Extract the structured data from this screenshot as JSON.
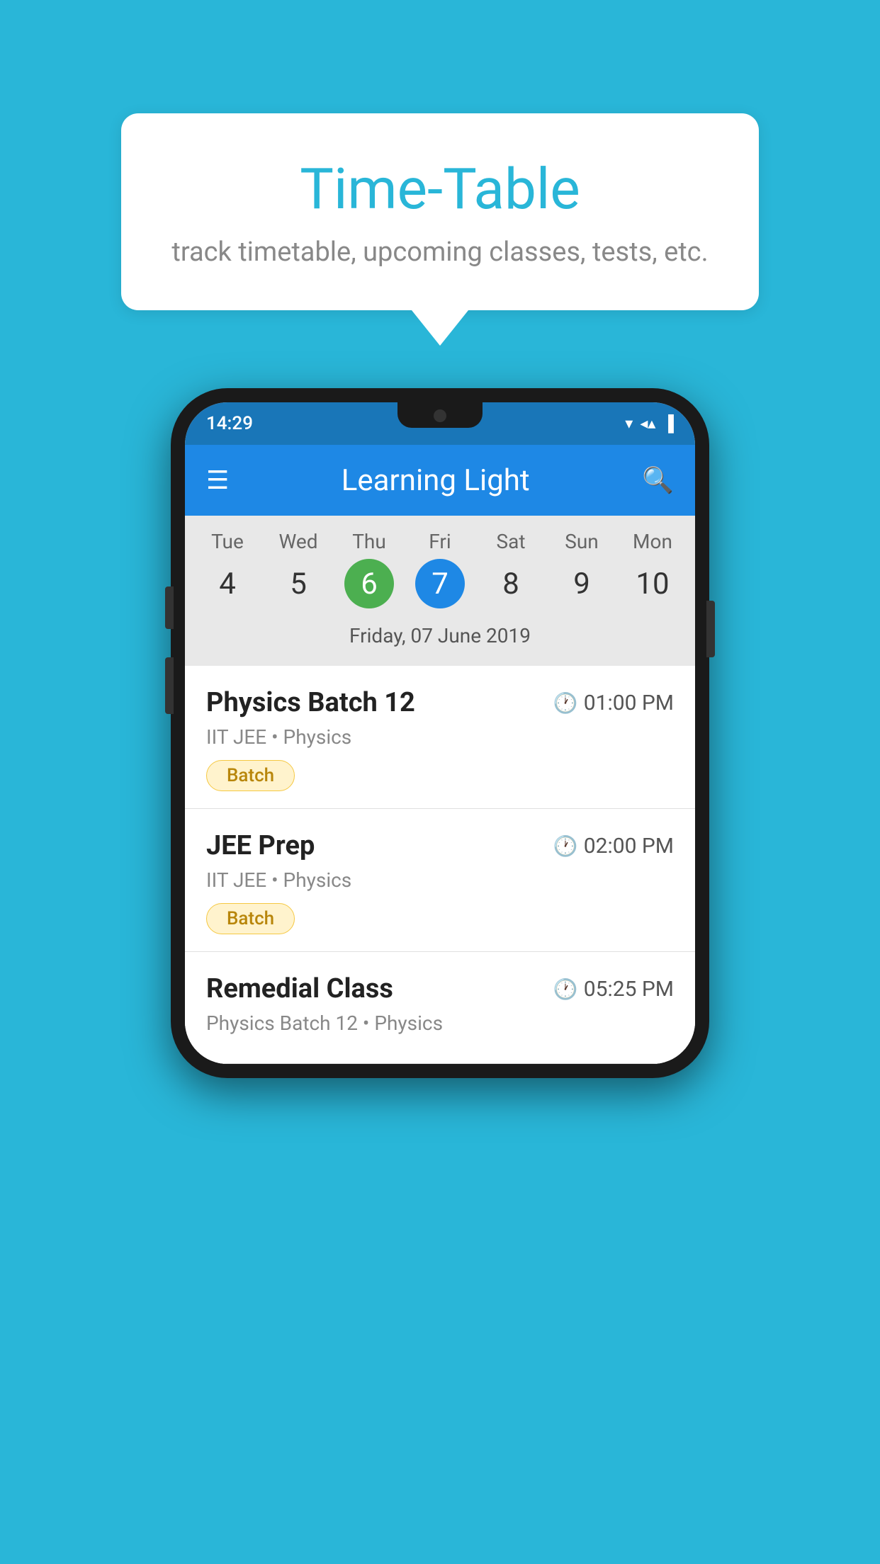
{
  "background_color": "#29b6d8",
  "speech_bubble": {
    "title": "Time-Table",
    "subtitle": "track timetable, upcoming classes, tests, etc."
  },
  "phone": {
    "status_bar": {
      "time": "14:29"
    },
    "app_bar": {
      "title": "Learning Light"
    },
    "calendar": {
      "days": [
        {
          "name": "Tue",
          "number": "4",
          "state": "normal"
        },
        {
          "name": "Wed",
          "number": "5",
          "state": "normal"
        },
        {
          "name": "Thu",
          "number": "6",
          "state": "today"
        },
        {
          "name": "Fri",
          "number": "7",
          "state": "selected"
        },
        {
          "name": "Sat",
          "number": "8",
          "state": "normal"
        },
        {
          "name": "Sun",
          "number": "9",
          "state": "normal"
        },
        {
          "name": "Mon",
          "number": "10",
          "state": "normal"
        }
      ],
      "selected_date_label": "Friday, 07 June 2019"
    },
    "schedule_items": [
      {
        "title": "Physics Batch 12",
        "time": "01:00 PM",
        "subtitle": "IIT JEE • Physics",
        "badge": "Batch"
      },
      {
        "title": "JEE Prep",
        "time": "02:00 PM",
        "subtitle": "IIT JEE • Physics",
        "badge": "Batch"
      },
      {
        "title": "Remedial Class",
        "time": "05:25 PM",
        "subtitle": "Physics Batch 12 • Physics",
        "badge": null
      }
    ]
  }
}
